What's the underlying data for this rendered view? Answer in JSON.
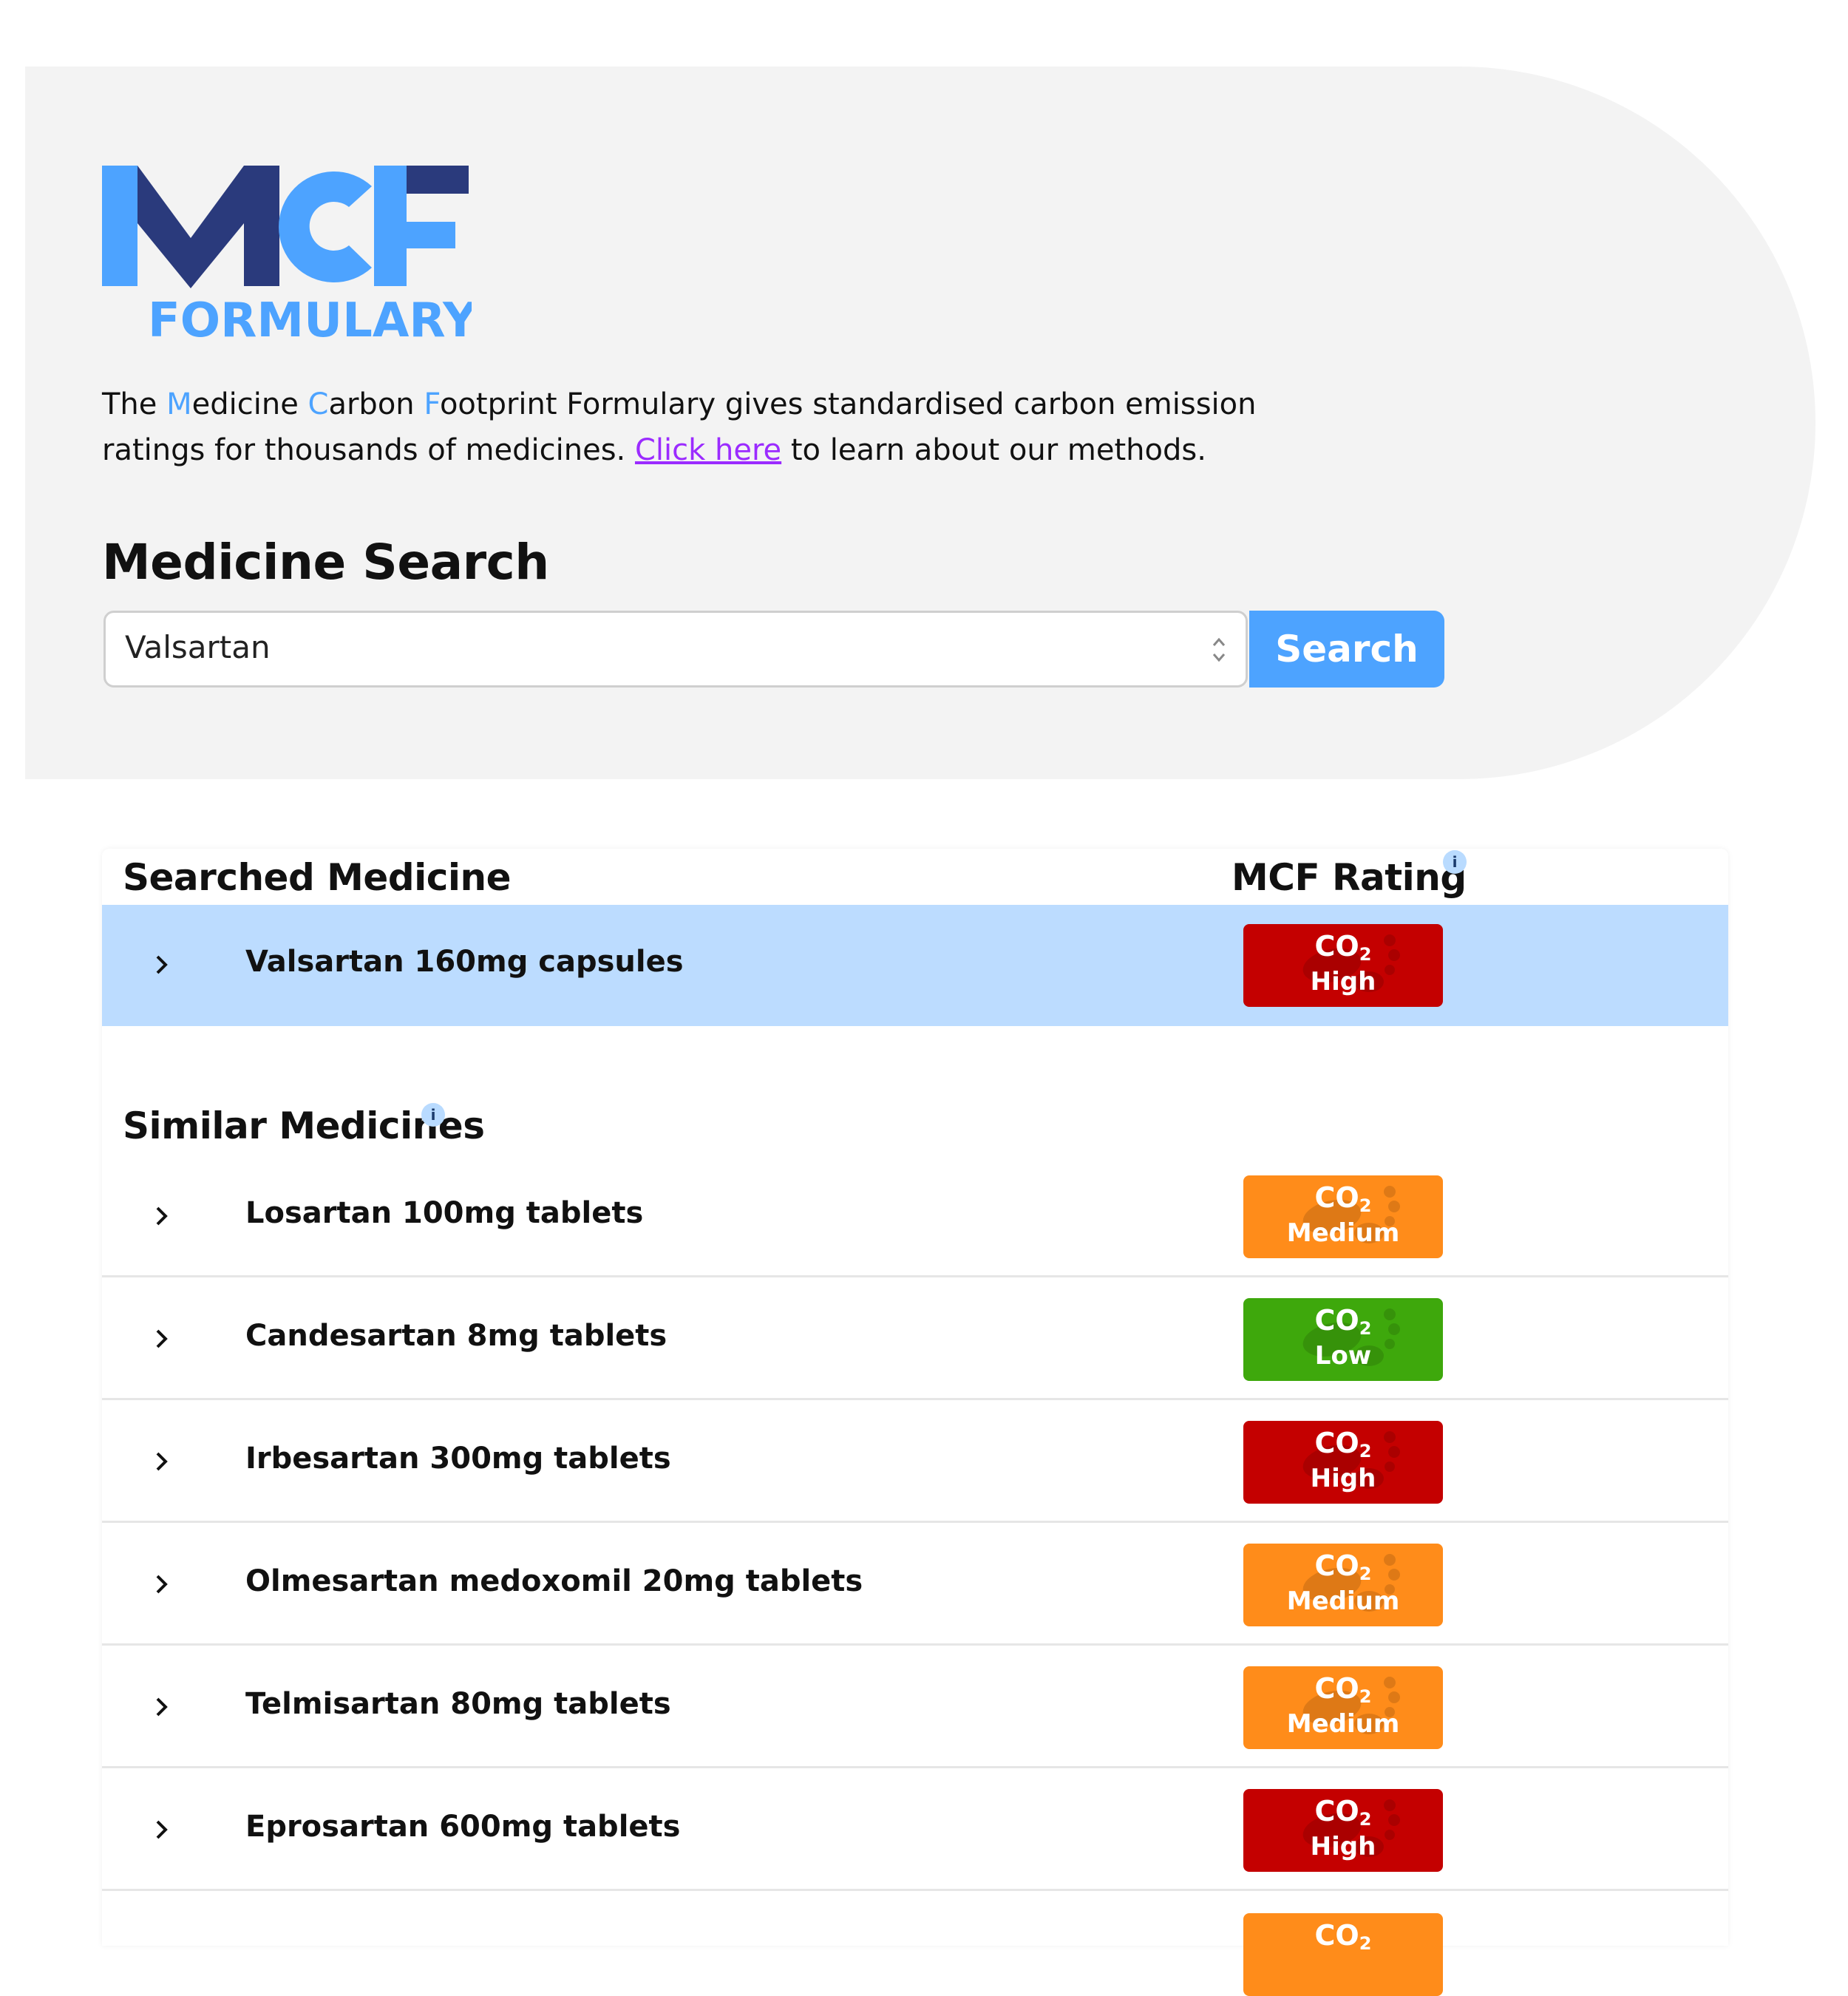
{
  "logo": {
    "letters": "MCF",
    "subtitle": "FORMULARY",
    "colors": {
      "dark": "#2a3a7c",
      "light": "#4da3ff"
    }
  },
  "intro": {
    "p1": "The ",
    "m": "M",
    "p2": "edicine ",
    "c": "C",
    "p3": "arbon ",
    "f": "F",
    "p4": "ootprint Formulary gives standardised carbon emission ratings for thousands of medicines. ",
    "link": "Click here",
    "p5": " to learn about our methods."
  },
  "search": {
    "title": "Medicine Search",
    "value": "Valsartan",
    "button": "Search"
  },
  "results": {
    "searched_header": "Searched Medicine",
    "rating_header": "MCF Rating",
    "info_glyph": "i",
    "similar_header": "Similar Medicines",
    "co2": "CO",
    "co2_sub": "2",
    "searched": {
      "name": "Valsartan 160mg capsules",
      "rating": "High"
    },
    "similar": [
      {
        "name": "Losartan 100mg tablets",
        "rating": "Medium"
      },
      {
        "name": "Candesartan 8mg tablets",
        "rating": "Low"
      },
      {
        "name": "Irbesartan 300mg tablets",
        "rating": "High"
      },
      {
        "name": "Olmesartan medoxomil 20mg tablets",
        "rating": "Medium"
      },
      {
        "name": "Telmisartan 80mg tablets",
        "rating": "Medium"
      },
      {
        "name": "Eprosartan 600mg tablets",
        "rating": "High"
      }
    ],
    "rating_colors": {
      "High": "#c40000",
      "Medium": "#ff8c1a",
      "Low": "#3ea80c"
    }
  }
}
